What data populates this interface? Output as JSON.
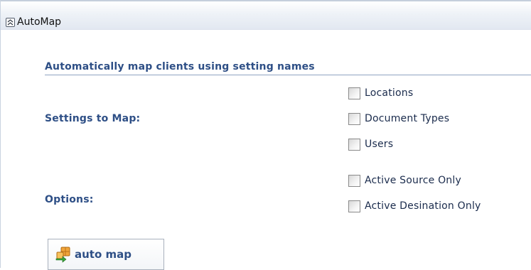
{
  "panel": {
    "title": "AutoMap",
    "collapse_icon": "double-chevron-up-icon"
  },
  "section": {
    "title": "Automatically map clients using setting names"
  },
  "settings_to_map": {
    "label": "Settings to Map:",
    "options": [
      {
        "label": "Locations",
        "checked": false
      },
      {
        "label": "Document Types",
        "checked": false
      },
      {
        "label": "Users",
        "checked": false
      }
    ]
  },
  "options": {
    "label": "Options:",
    "options": [
      {
        "label": "Active Source Only",
        "checked": false
      },
      {
        "label": "Active Desination Only",
        "checked": false
      }
    ]
  },
  "auto_map_button": {
    "label": "auto map",
    "icon": "auto-map-icon"
  },
  "colors": {
    "label_blue": "#2e4f86",
    "text": "#1a2b4c"
  }
}
